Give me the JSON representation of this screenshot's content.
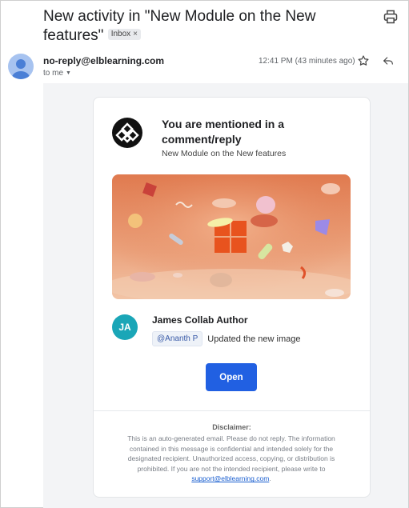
{
  "email": {
    "subject": "New activity in \"New Module on the New features\"",
    "label": "Inbox",
    "label_remove": "×",
    "sender": "no-reply@elblearning.com",
    "recipient": "to me",
    "timestamp": "12:41 PM (43 minutes ago)"
  },
  "card": {
    "title": "You are mentioned in a comment/reply",
    "subtitle": "New Module on the New features",
    "author_initials": "JA",
    "author_name": "James Collab Author",
    "mention_tag": "@Ananth P",
    "comment": "Updated the new image",
    "button_label": "Open",
    "disclaimer_title": "Disclaimer:",
    "disclaimer_body": "This is an auto-generated email. Please do not reply. The information contained in this message is confidential and intended solely for the designated recipient. Unauthorized access, copying, or distribution is prohibited. If you are not the intended recipient, please write to",
    "support_email": "support@elblearning.com",
    "disclaimer_end": "."
  },
  "icons": {
    "print": "print-icon",
    "star": "star-icon",
    "reply": "reply-icon",
    "caret": "chevron-down-icon",
    "sender_avatar": "person-avatar-icon",
    "brand_logo": "elb-logo-icon"
  },
  "colors": {
    "primary_button": "#2160e2",
    "author_avatar": "#1aa6b7",
    "link": "#1a5fd0",
    "hero_background": "#e9916a"
  }
}
